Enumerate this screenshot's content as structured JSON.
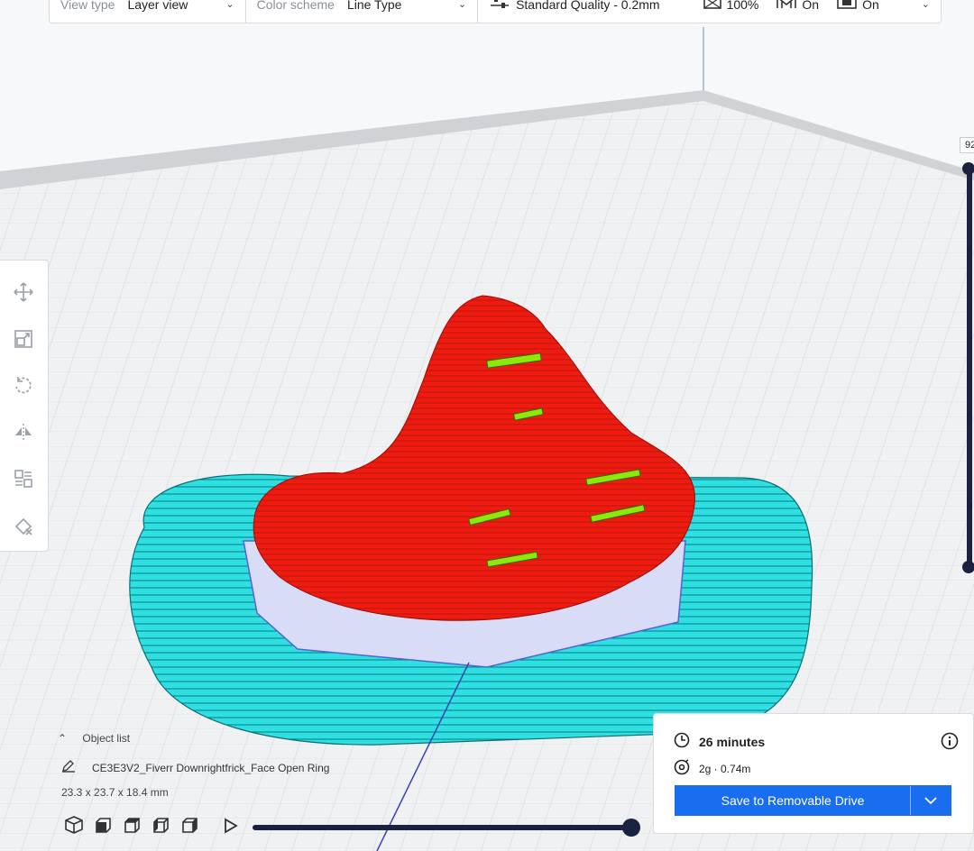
{
  "toolbar": {
    "view_type_label": "View type",
    "view_type_value": "Layer view",
    "color_scheme_label": "Color scheme",
    "color_scheme_value": "Line Type",
    "quality_value": "Standard Quality - 0.2mm",
    "infill_value": "100%",
    "support_value": "On",
    "adhesion_value": "On"
  },
  "left_tools": [
    "move-icon",
    "scale-icon",
    "rotate-icon",
    "mirror-icon",
    "per-model-settings-icon",
    "support-blocker-icon"
  ],
  "layer_slider": {
    "current_layer_label": "92"
  },
  "object_list": {
    "header": "Object list",
    "object_name": "CE3E3V2_Fiverr Downrightfrick_Face Open Ring",
    "dimensions": "23.3 x 23.7 x 18.4 mm"
  },
  "view_buttons": [
    "3d-view-icon",
    "front-view-icon",
    "top-view-icon",
    "left-view-icon",
    "right-view-icon"
  ],
  "print_info": {
    "time": "26 minutes",
    "material": "2g · 0.74m",
    "save_button": "Save to Removable Drive"
  },
  "colors": {
    "accent": "#196ef0",
    "model_wall": "#e8190f",
    "skirt": "#22d3d6",
    "slider": "#1b2140"
  }
}
